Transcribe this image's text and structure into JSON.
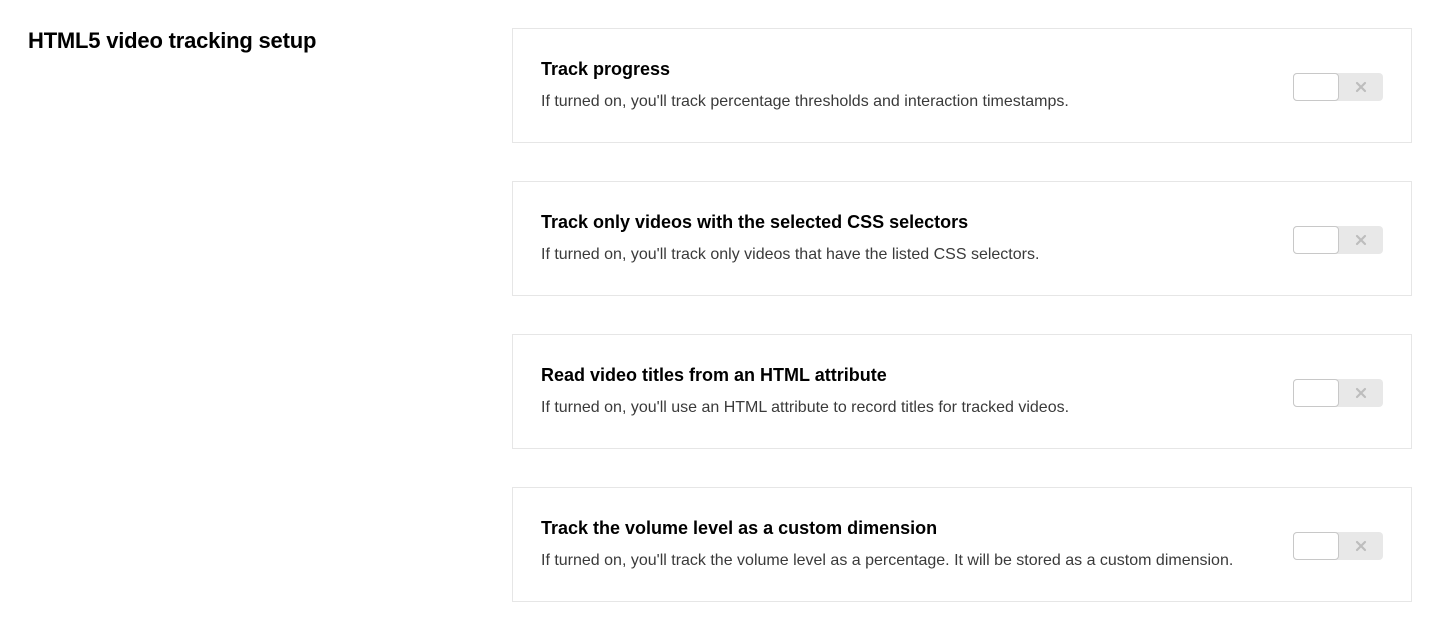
{
  "section_title": "HTML5 video tracking setup",
  "items": [
    {
      "title": "Track progress",
      "description": "If turned on, you'll track percentage thresholds and interaction timestamps.",
      "enabled": false
    },
    {
      "title": "Track only videos with the selected CSS selectors",
      "description": "If turned on, you'll track only videos that have the listed CSS selectors.",
      "enabled": false
    },
    {
      "title": "Read video titles from an HTML attribute",
      "description": "If turned on, you'll use an HTML attribute to record titles for tracked videos.",
      "enabled": false
    },
    {
      "title": "Track the volume level as a custom dimension",
      "description": "If turned on, you'll track the volume level as a percentage. It will be stored as a custom dimension.",
      "enabled": false
    }
  ]
}
